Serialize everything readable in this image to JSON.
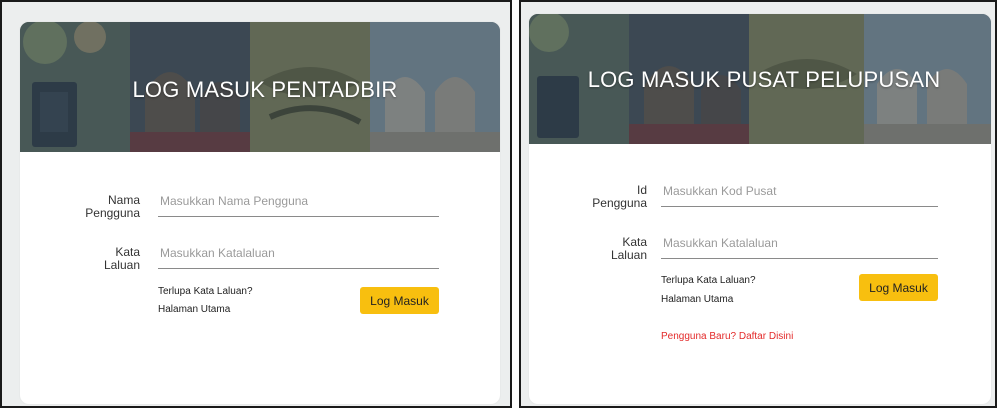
{
  "panel_left": {
    "title": "LOG MASUK PENTADBIR",
    "username": {
      "label_line1": "Nama",
      "label_line2": "Pengguna",
      "placeholder": "Masukkan Nama Pengguna"
    },
    "password": {
      "label_line1": "Kata",
      "label_line2": "Laluan",
      "placeholder": "Masukkan Katalaluan"
    },
    "forgot_link": "Terlupa Kata Laluan?",
    "home_link": "Halaman Utama",
    "login_button": "Log Masuk"
  },
  "panel_right": {
    "title": "LOG MASUK PUSAT PELUPUSAN",
    "userid": {
      "label_line1": "Id",
      "label_line2": "Pengguna",
      "placeholder": "Masukkan Kod Pusat"
    },
    "password": {
      "label_line1": "Kata",
      "label_line2": "Laluan",
      "placeholder": "Masukkan Katalaluan"
    },
    "forgot_link": "Terlupa Kata Laluan?",
    "home_link": "Halaman Utama",
    "login_button": "Log Masuk",
    "register_link": "Pengguna Baru? Daftar Disini"
  },
  "colors": {
    "accent_button": "#f8bf0f",
    "register_link": "#e32a2a",
    "banner_overlay": "#2c3e50"
  }
}
